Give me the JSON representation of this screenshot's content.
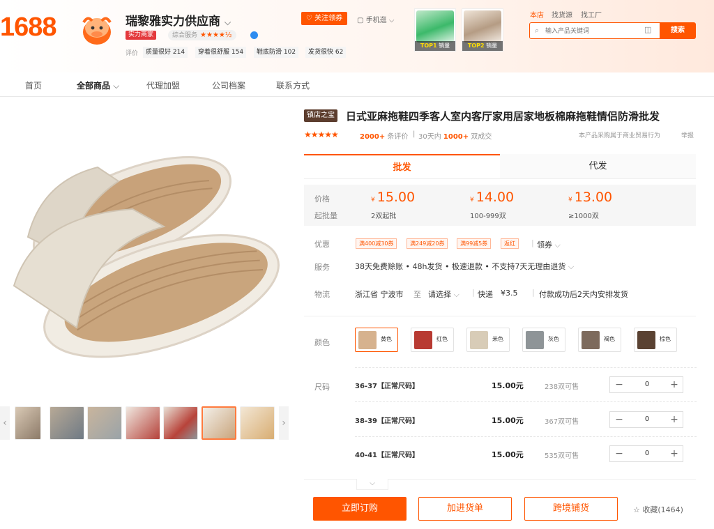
{
  "brand": {
    "logo": "1688"
  },
  "shop": {
    "name": "瑞黎雅实力供应商",
    "badge": "实力商家",
    "service_label": "综合服务",
    "service_stars": "★★★★½",
    "follow": "关注领券",
    "mobile": "手机逛",
    "eval_label": "评价",
    "evals": [
      "质量很好 214",
      "穿着很舒服 154",
      "鞋底防滑 102",
      "发货很快 62"
    ]
  },
  "top_products": [
    {
      "rank": "TOP1",
      "label": "销量"
    },
    {
      "rank": "TOP2",
      "label": "销量"
    }
  ],
  "search": {
    "tabs": [
      "本店",
      "找货源",
      "找工厂"
    ],
    "placeholder": "输入产品关键词",
    "button": "搜索"
  },
  "nav": [
    "首页",
    "全部商品",
    "代理加盟",
    "公司档案",
    "联系方式"
  ],
  "product": {
    "tag": "镇店之宝",
    "title": "日式亚麻拖鞋四季客人室内客厅家用居家地板棉麻拖鞋情侣防滑批发",
    "stars": "★★★★★",
    "reviews": "2000+",
    "reviews_unit": "条评价",
    "sold_prefix": "30天内",
    "sold": "1000+",
    "sold_unit": "双成交",
    "compliance": "本产品采购属于商业贸易行为",
    "report": "举报"
  },
  "tabs": [
    "批发",
    "代发"
  ],
  "pricing": {
    "price_label": "价格",
    "qty_label": "起批量",
    "currency": "¥",
    "tiers": [
      {
        "price": "15.00",
        "qty": "2双起批"
      },
      {
        "price": "14.00",
        "qty": "100-999双"
      },
      {
        "price": "13.00",
        "qty": "≥1000双"
      }
    ]
  },
  "discount": {
    "label": "优惠",
    "coupons": [
      "满400减30券",
      "满249减20券",
      "满99减5券",
      "返红"
    ],
    "get": "领券"
  },
  "service": {
    "label": "服务",
    "text": "38天免费赊账 • 48h发货 • 极速退款 • 不支持7天无理由退货"
  },
  "logistics": {
    "label": "物流",
    "from": "浙江省 宁波市",
    "to": "至",
    "select": "请选择",
    "express": "快递",
    "fee": "¥3.5",
    "ship": "付款成功后2天内安排发货"
  },
  "colors": {
    "label": "颜色",
    "items": [
      {
        "name": "黄色",
        "swatch": "#d6b28e"
      },
      {
        "name": "红色",
        "swatch": "#b83a32"
      },
      {
        "name": "米色",
        "swatch": "#d8ccb7"
      },
      {
        "name": "灰色",
        "swatch": "#8e9497"
      },
      {
        "name": "褐色",
        "swatch": "#7d6a5c"
      },
      {
        "name": "棕色",
        "swatch": "#5a4232"
      }
    ]
  },
  "sizes": {
    "label": "尺码",
    "rows": [
      {
        "size": "36-37【正常尺码】",
        "price": "15.00元",
        "stock": "238双可售",
        "qty": "0"
      },
      {
        "size": "38-39【正常尺码】",
        "price": "15.00元",
        "stock": "367双可售",
        "qty": "0"
      },
      {
        "size": "40-41【正常尺码】",
        "price": "15.00元",
        "stock": "535双可售",
        "qty": "0"
      }
    ]
  },
  "actions": {
    "buy": "立即订购",
    "cart": "加进货单",
    "cross": "跨境铺货",
    "fav": "收藏(1464)"
  },
  "accent": "#ff5500"
}
